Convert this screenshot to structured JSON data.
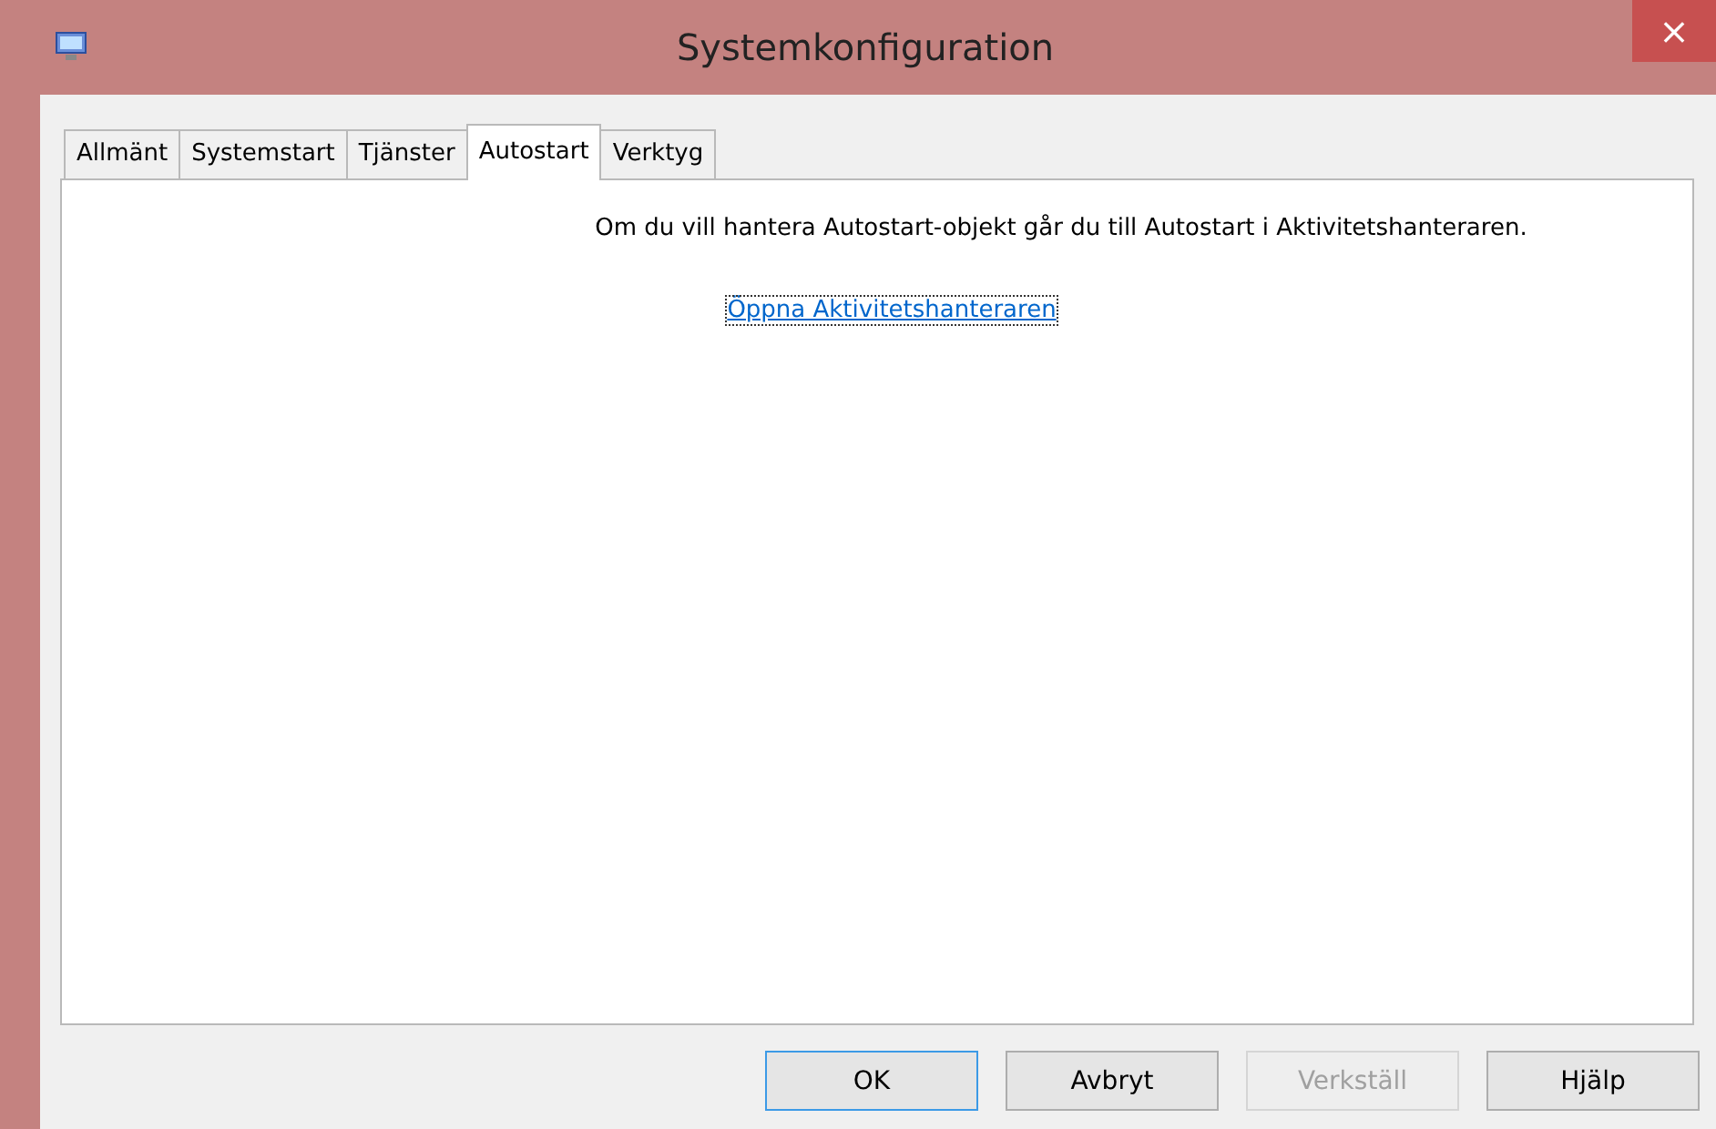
{
  "window": {
    "title": "Systemkonfiguration",
    "close": "×"
  },
  "tabs": [
    {
      "label": "Allmänt",
      "selected": false
    },
    {
      "label": "Systemstart",
      "selected": false
    },
    {
      "label": "Tjänster",
      "selected": false
    },
    {
      "label": "Autostart",
      "selected": true
    },
    {
      "label": "Verktyg",
      "selected": false
    }
  ],
  "panel": {
    "message": "Om du vill hantera Autostart-objekt går du till Autostart i Aktivitetshanteraren.",
    "link": "Öppna Aktivitetshanteraren"
  },
  "buttons": [
    {
      "label": "OK",
      "default": true,
      "disabled": false
    },
    {
      "label": "Avbryt",
      "default": false,
      "disabled": false
    },
    {
      "label": "Verkställ",
      "default": false,
      "disabled": true
    },
    {
      "label": "Hjälp",
      "default": false,
      "disabled": false
    }
  ]
}
